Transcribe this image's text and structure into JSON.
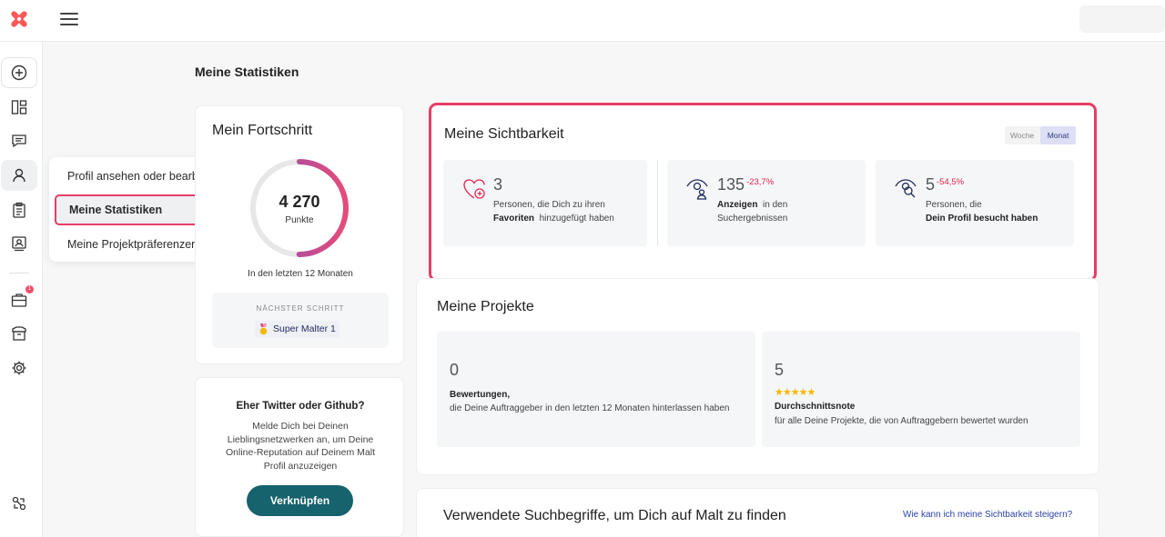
{
  "header": {
    "logo_icon": "malt-logo-icon",
    "menu_icon": "hamburger-icon"
  },
  "sidebar": {
    "items": [
      {
        "icon": "plus-circle-icon"
      },
      {
        "icon": "dashboard-icon"
      },
      {
        "icon": "chat-icon"
      },
      {
        "icon": "profile-icon"
      },
      {
        "icon": "clipboard-icon"
      },
      {
        "icon": "id-card-icon"
      },
      {
        "icon": "briefcase-icon",
        "badge": "1"
      },
      {
        "icon": "archive-icon"
      },
      {
        "icon": "gear-icon"
      },
      {
        "icon": "help-icon"
      }
    ]
  },
  "submenu": {
    "items": [
      "Profil ansehen oder bearbeiten",
      "Meine Statistiken",
      "Meine Projektpräferenzen"
    ]
  },
  "page": {
    "title": "Meine Statistiken"
  },
  "progress": {
    "title": "Mein Fortschritt",
    "points": "4 270",
    "points_unit": "Punkte",
    "period": "In den letzten 12 Monaten",
    "next_label": "NÄCHSTER SCHRITT",
    "next_level": "Super Malter 1",
    "ring_fraction": 0.5
  },
  "social": {
    "title": "Eher Twitter oder Github?",
    "text": "Melde Dich bei Deinen Lieblingsnetzwerken an, um Deine Online-Reputation auf Deinem Malt Profil anzuzeigen",
    "button": "Verknüpfen"
  },
  "visibility": {
    "title": "Meine Sichtbarkeit",
    "toggle": [
      "Woche",
      "Monat"
    ],
    "stats": [
      {
        "value": "3",
        "delta": "",
        "line1": "Personen, die Dich zu ihren",
        "bold": "Favoriten",
        "line2": "hinzugefügt haben"
      },
      {
        "value": "135",
        "delta": "-23,7%",
        "bold": "Anzeigen",
        "line1": "in den",
        "line2": "Suchergebnissen"
      },
      {
        "value": "5",
        "delta": "-54,5%",
        "line1": "Personen, die",
        "bold": "Dein Profil besucht haben"
      }
    ]
  },
  "projects": {
    "title": "Meine Projekte",
    "items": [
      {
        "value": "0",
        "label": "Bewertungen,",
        "desc": "die Deine Auftraggeber in den letzten 12 Monaten hinterlassen haben"
      },
      {
        "value": "5",
        "stars": "★★★★★",
        "label": "Durchschnittsnote",
        "desc": "für alle Deine Projekte, die von Auftraggebern bewertet wurden"
      }
    ]
  },
  "search_terms": {
    "title": "Verwendete Suchbegriffe, um Dich auf Malt zu finden",
    "link": "Wie kann ich meine Sichtbarkeit steigern?"
  }
}
